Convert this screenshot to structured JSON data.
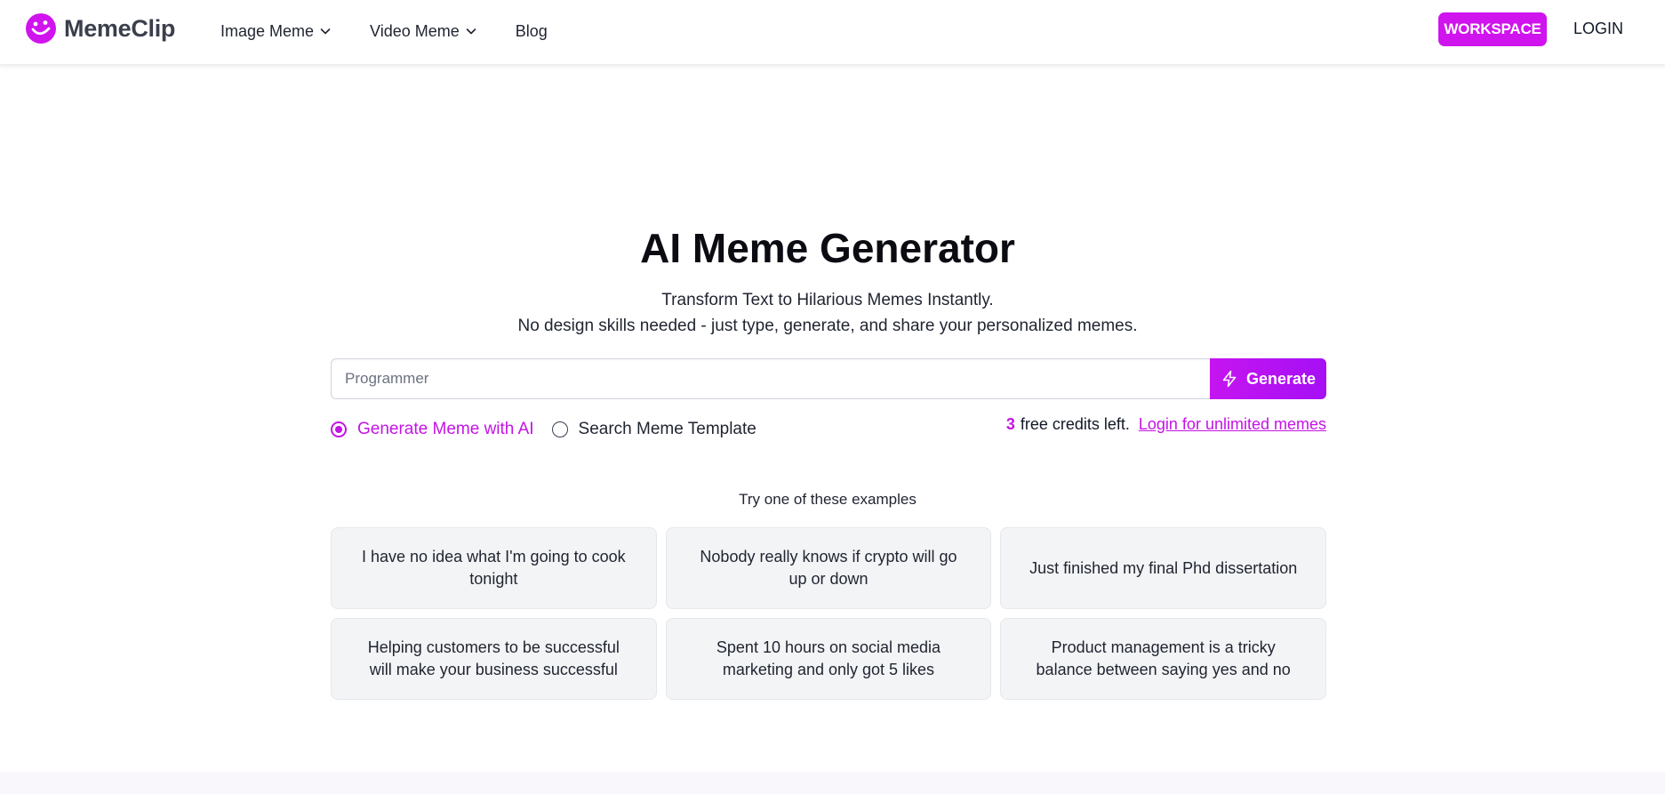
{
  "header": {
    "logo_text": "MemeClip",
    "nav": [
      {
        "label": "Image Meme",
        "has_dropdown": true
      },
      {
        "label": "Video Meme",
        "has_dropdown": true
      },
      {
        "label": "Blog",
        "has_dropdown": false
      }
    ],
    "workspace_label": "WORKSPACE",
    "login_label": "LOGIN"
  },
  "hero": {
    "title": "AI Meme Generator",
    "subtitle_1": "Transform Text to Hilarious Memes Instantly.",
    "subtitle_2": "No design skills needed - just type, generate, and share your personalized memes."
  },
  "search": {
    "placeholder": "Programmer",
    "value": "",
    "generate_label": "Generate"
  },
  "modes": {
    "ai_label": "Generate Meme with AI",
    "template_label": "Search Meme Template",
    "selected": "ai"
  },
  "credits": {
    "count": "3",
    "text": "free credits left.",
    "login_link": "Login for unlimited memes"
  },
  "examples": {
    "title": "Try one of these examples",
    "items": [
      "I have no idea what I'm going to cook tonight",
      "Nobody really knows if crypto will go up or down",
      "Just finished my final Phd dissertation",
      "Helping customers to be successful will make your business successful",
      "Spent 10 hours on social media marketing and only got 5 likes",
      "Product management is a tricky balance between saying yes and no"
    ]
  },
  "colors": {
    "accent": "#c513e6",
    "workspace_bg": "#d014ee",
    "card_bg": "#f3f4f6"
  },
  "icons": {
    "logo": "smiley-face-icon",
    "dropdown": "chevron-down-icon",
    "generate": "lightning-bolt-icon"
  }
}
